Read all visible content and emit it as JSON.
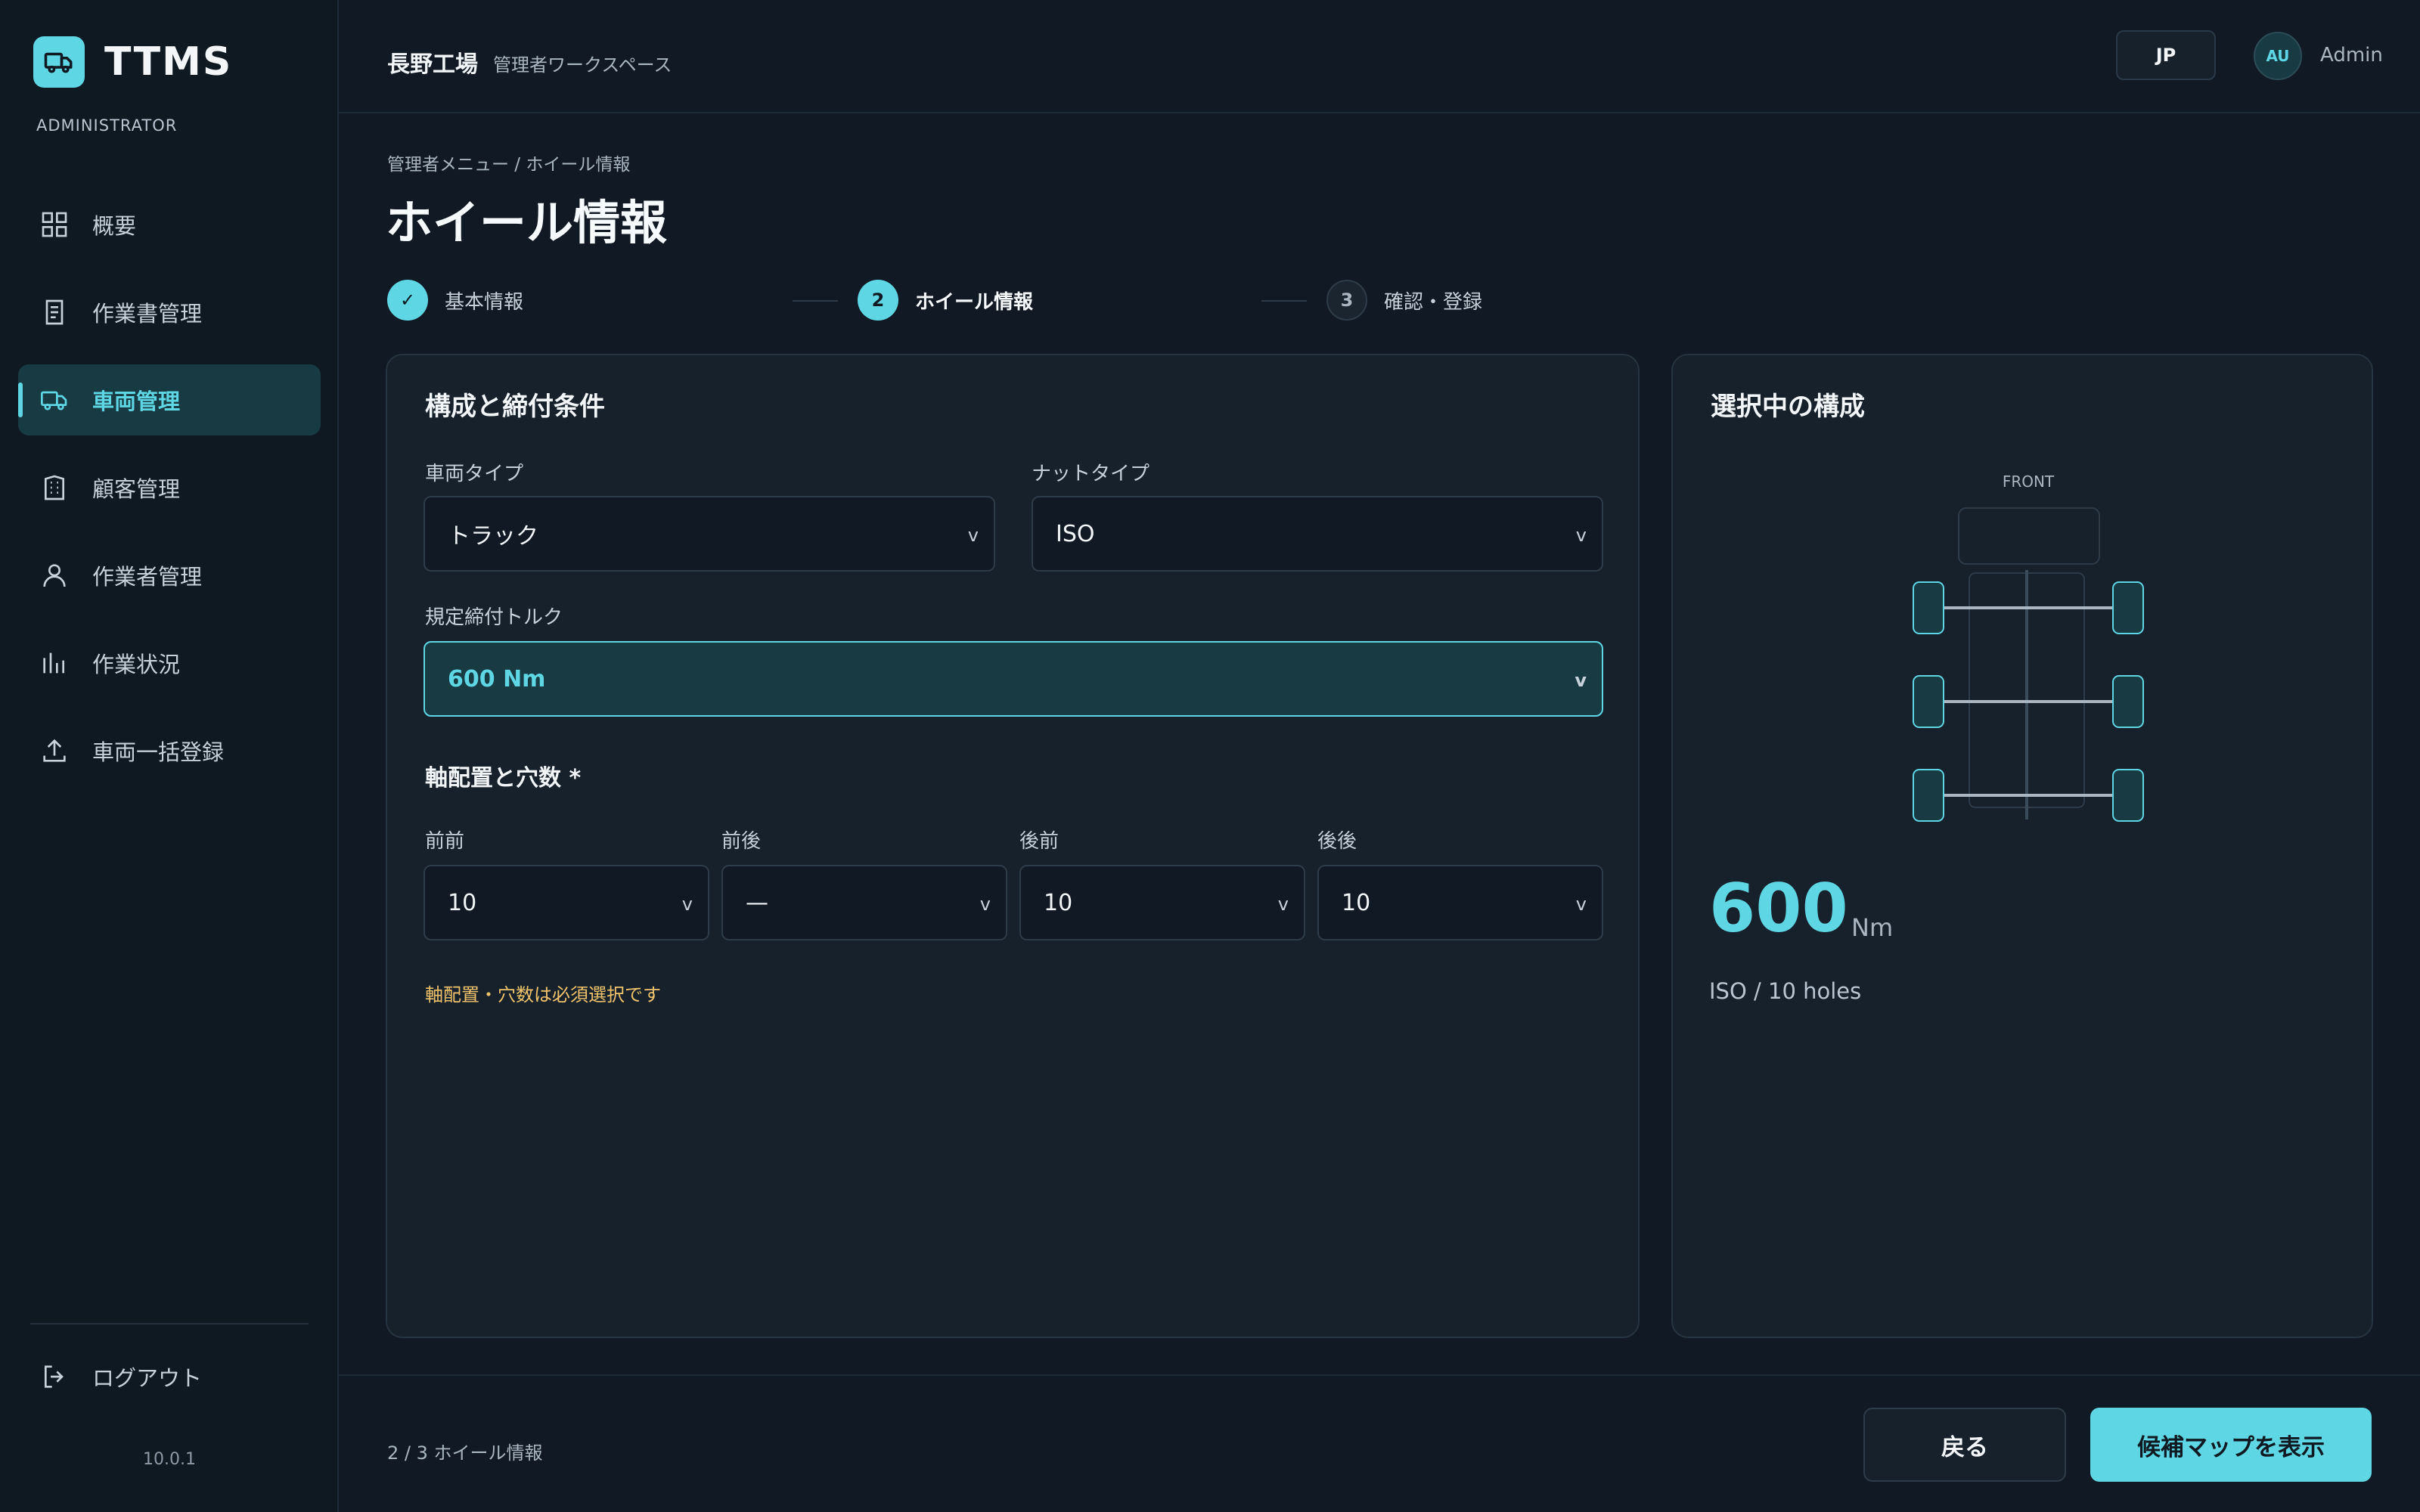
{
  "brand": {
    "name": "TTMS",
    "role": "ADMINISTRATOR"
  },
  "sidebar": {
    "items": [
      {
        "label": "概要",
        "icon": "grid-icon"
      },
      {
        "label": "作業書管理",
        "icon": "document-icon"
      },
      {
        "label": "車両管理",
        "icon": "truck-icon",
        "active": true
      },
      {
        "label": "顧客管理",
        "icon": "building-icon"
      },
      {
        "label": "作業者管理",
        "icon": "person-icon"
      },
      {
        "label": "作業状況",
        "icon": "bar-chart-icon"
      },
      {
        "label": "車両一括登録",
        "icon": "upload-icon"
      }
    ],
    "logout": "ログアウト",
    "version": "10.0.1"
  },
  "header": {
    "site": "長野工場",
    "subtitle": "管理者ワークスペース",
    "lang": "JP",
    "avatar_initials": "AU",
    "user": "Admin"
  },
  "page": {
    "breadcrumb": "管理者メニュー / ホイール情報",
    "title": "ホイール情報"
  },
  "stepper": {
    "steps": [
      {
        "number": "✓",
        "label": "基本情報",
        "state": "done"
      },
      {
        "number": "2",
        "label": "ホイール情報",
        "state": "current"
      },
      {
        "number": "3",
        "label": "確認・登録",
        "state": "todo"
      }
    ]
  },
  "form": {
    "title": "構成と締付条件",
    "vehicle_type": {
      "label": "車両タイプ",
      "value": "トラック"
    },
    "nut_type": {
      "label": "ナットタイプ",
      "value": "ISO"
    },
    "torque": {
      "label": "規定締付トルク",
      "value": "600 Nm"
    },
    "axle_section": "軸配置と穴数 *",
    "axles": [
      {
        "label": "前前",
        "value": "10"
      },
      {
        "label": "前後",
        "value": "—"
      },
      {
        "label": "後前",
        "value": "10"
      },
      {
        "label": "後後",
        "value": "10"
      }
    ],
    "chevron": "v",
    "warning": "軸配置・穴数は必須選択です"
  },
  "summary": {
    "title": "選択中の構成",
    "front_label": "FRONT",
    "torque_value": "600",
    "torque_unit": "Nm",
    "detail": "ISO / 10 holes"
  },
  "footer": {
    "status": "2 / 3 ホイール情報",
    "back": "戻る",
    "primary": "候補マップを表示"
  },
  "colors": {
    "accent": "#5ed6e4",
    "background": "#111a24",
    "card": "#16212c",
    "warning": "#f0c36a"
  }
}
